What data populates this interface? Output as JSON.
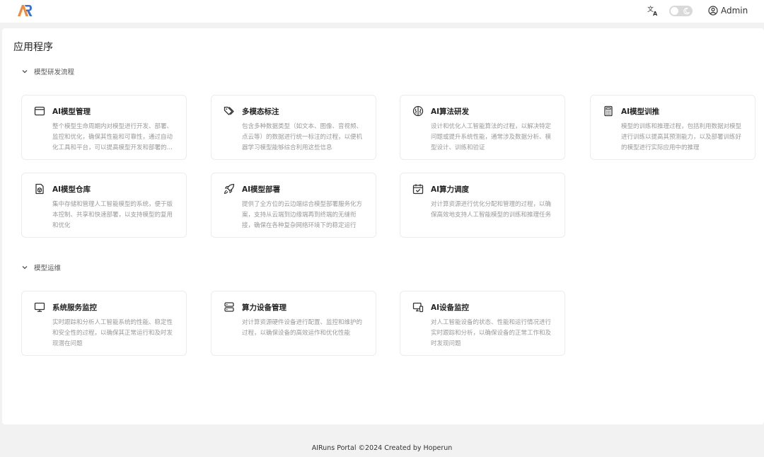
{
  "header": {
    "logo_text": "AR",
    "user_name": "Admin"
  },
  "page_title": "应用程序",
  "sections": [
    {
      "title": "模型研发流程",
      "cards": [
        {
          "title": "AI模型管理",
          "icon": "browser-window-icon",
          "desc": "整个模型生命周期内对模型进行开发、部署、监控和优化，确保其性能和可靠性，通过自动化工具和平台，可以提高模型开发和部署的效率"
        },
        {
          "title": "多模态标注",
          "icon": "tags-icon",
          "desc": "包含多种数据类型（如文本、图像、音视频、点云等）的数据进行统一标注的过程，以便机器学习模型能够综合利用这些信息"
        },
        {
          "title": "AI算法研发",
          "icon": "brain-icon",
          "desc": "设计和优化人工智能算法的过程，以解决特定问题或提升系统性能，通常涉及数据分析、模型设计、训练和验证"
        },
        {
          "title": "AI模型训推",
          "icon": "calculator-icon",
          "desc": "模型的训练和推理过程，包括利用数据对模型进行训练以提高其预测能力，以及部署训练好的模型进行实际应用中的推理"
        },
        {
          "title": "AI模型仓库",
          "icon": "model-repo-icon",
          "desc": "集中存储和管理人工智能模型的系统，便于版本控制、共享和快速部署，以支持模型的复用和优化"
        },
        {
          "title": "AI模型部署",
          "icon": "rocket-icon",
          "desc": "提供了全方位的云边端综合模型部署服务化方案，支持从云端到边缘端再到终端的无缝衔接，确保在各种复杂网络环境下的稳定运行"
        },
        {
          "title": "AI算力调度",
          "icon": "calendar-check-icon",
          "desc": "对计算资源进行优化分配和管理的过程，以确保高效地支持人工智能模型的训练和推理任务"
        }
      ]
    },
    {
      "title": "模型运维",
      "cards": [
        {
          "title": "系统服务监控",
          "icon": "monitor-icon",
          "desc": "实时跟踪和分析人工智能系统的性能、稳定性和安全性的过程，以确保其正常运行和及时发现潜在问题"
        },
        {
          "title": "算力设备管理",
          "icon": "server-icon",
          "desc": "对计算资源硬件设备进行配置、监控和维护的过程，以确保设备的高效运作和优化性能"
        },
        {
          "title": "AI设备监控",
          "icon": "device-monitor-icon",
          "desc": "对人工智能设备的状态、性能和运行情况进行实时跟踪和分析，以确保设备的正常工作和及时发现问题"
        }
      ]
    }
  ],
  "footer": "AIRuns Portal ©2024 Created by Hoperun",
  "colors": {
    "logo_orange": "#f08a3c",
    "logo_blue": "#3b6fd8",
    "text_muted": "#9a9a9a"
  }
}
